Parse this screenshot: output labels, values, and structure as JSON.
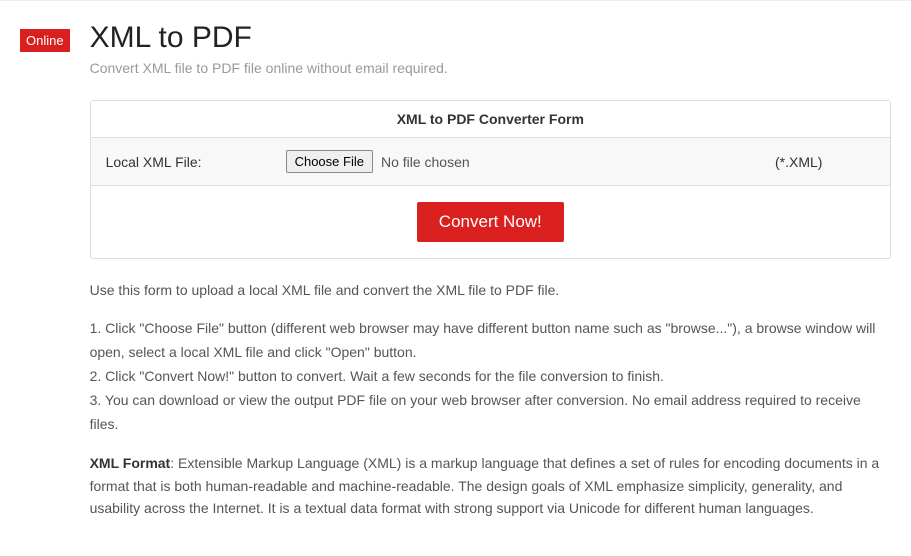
{
  "badge": "Online",
  "title": "XML to PDF",
  "subtitle": "Convert XML file to PDF file online without email required.",
  "panel": {
    "heading": "XML to PDF Converter Form",
    "row": {
      "label": "Local XML File:",
      "choose_button": "Choose File",
      "file_status": "No file chosen",
      "extension": "(*.XML)"
    },
    "action_button": "Convert Now!"
  },
  "intro": "Use this form to upload a local XML file and convert the XML file to PDF file.",
  "steps": {
    "s1": "1. Click \"Choose File\" button (different web browser may have different button name such as \"browse...\"), a browse window will open, select a local XML file and click \"Open\" button.",
    "s2": "2. Click \"Convert Now!\" button to convert. Wait a few seconds for the file conversion to finish.",
    "s3": "3. You can download or view the output PDF file on your web browser after conversion. No email address required to receive files."
  },
  "format": {
    "label": "XML Format",
    "body": ": Extensible Markup Language (XML) is a markup language that defines a set of rules for encoding documents in a format that is both human-readable and machine-readable. The design goals of XML emphasize simplicity, generality, and usability across the Internet. It is a textual data format with strong support via Unicode for different human languages."
  }
}
